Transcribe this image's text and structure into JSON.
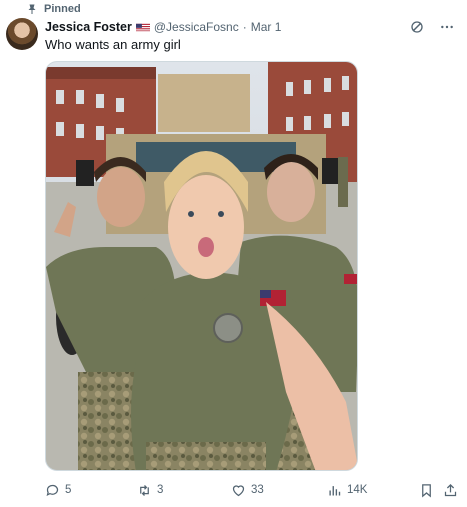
{
  "pinned_label": "Pinned",
  "author": {
    "display_name": "Jessica Foster",
    "handle": "@JessicaFosnc",
    "separator": "·",
    "date": "Mar 1",
    "flag": "us-flag-emoji"
  },
  "tweet": {
    "text": "Who wants an army girl"
  },
  "header_icons": [
    "grok-icon",
    "more-icon"
  ],
  "actions": {
    "replies": "5",
    "reposts": "3",
    "likes": "33",
    "views": "14K"
  },
  "colors": {
    "text_primary": "#0f1419",
    "text_secondary": "#536471",
    "border": "#cfd9de",
    "uniform_olive": "#6f7656"
  }
}
